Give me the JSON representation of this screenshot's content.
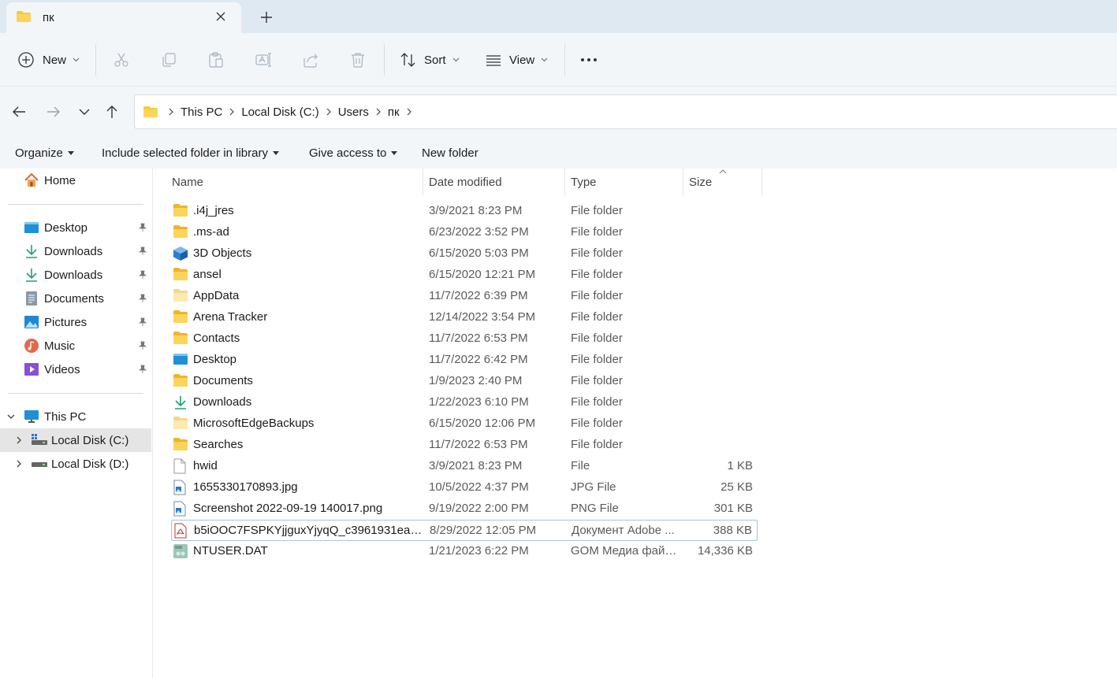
{
  "tab": {
    "title": "пк"
  },
  "toolbar": {
    "new_label": "New",
    "sort_label": "Sort",
    "view_label": "View"
  },
  "breadcrumb": [
    "This PC",
    "Local Disk (C:)",
    "Users",
    "пк"
  ],
  "legacy": {
    "organize": "Organize",
    "include": "Include selected folder in library",
    "give_access": "Give access to",
    "new_folder": "New folder"
  },
  "nav": {
    "home": "Home",
    "quick": [
      "Desktop",
      "Downloads",
      "Downloads",
      "Documents",
      "Pictures",
      "Music",
      "Videos"
    ],
    "this_pc": "This PC",
    "disk_c": "Local Disk (C:)",
    "disk_d": "Local Disk (D:)"
  },
  "columns": {
    "name": "Name",
    "date": "Date modified",
    "type": "Type",
    "size": "Size"
  },
  "files": [
    {
      "name": ".i4j_jres",
      "date": "3/9/2021 8:23 PM",
      "type": "File folder",
      "size": "",
      "icon": "folder"
    },
    {
      "name": ".ms-ad",
      "date": "6/23/2022 3:52 PM",
      "type": "File folder",
      "size": "",
      "icon": "folder"
    },
    {
      "name": "3D Objects",
      "date": "6/15/2020 5:03 PM",
      "type": "File folder",
      "size": "",
      "icon": "cube"
    },
    {
      "name": "ansel",
      "date": "6/15/2020 12:21 PM",
      "type": "File folder",
      "size": "",
      "icon": "folder"
    },
    {
      "name": "AppData",
      "date": "11/7/2022 6:39 PM",
      "type": "File folder",
      "size": "",
      "icon": "folder-light"
    },
    {
      "name": "Arena Tracker",
      "date": "12/14/2022 3:54 PM",
      "type": "File folder",
      "size": "",
      "icon": "folder"
    },
    {
      "name": "Contacts",
      "date": "11/7/2022 6:53 PM",
      "type": "File folder",
      "size": "",
      "icon": "folder"
    },
    {
      "name": "Desktop",
      "date": "11/7/2022 6:42 PM",
      "type": "File folder",
      "size": "",
      "icon": "desktop"
    },
    {
      "name": "Documents",
      "date": "1/9/2023 2:40 PM",
      "type": "File folder",
      "size": "",
      "icon": "folder"
    },
    {
      "name": "Downloads",
      "date": "1/22/2023 6:10 PM",
      "type": "File folder",
      "size": "",
      "icon": "download"
    },
    {
      "name": "MicrosoftEdgeBackups",
      "date": "6/15/2020 12:06 PM",
      "type": "File folder",
      "size": "",
      "icon": "folder-light"
    },
    {
      "name": "Searches",
      "date": "11/7/2022 6:53 PM",
      "type": "File folder",
      "size": "",
      "icon": "folder"
    },
    {
      "name": "hwid",
      "date": "3/9/2021 8:23 PM",
      "type": "File",
      "size": "1 KB",
      "icon": "file"
    },
    {
      "name": "1655330170893.jpg",
      "date": "10/5/2022 4:37 PM",
      "type": "JPG File",
      "size": "25 KB",
      "icon": "image"
    },
    {
      "name": "Screenshot 2022-09-19 140017.png",
      "date": "9/19/2022 2:00 PM",
      "type": "PNG File",
      "size": "301 KB",
      "icon": "image"
    },
    {
      "name": "b5iOOC7FSPKYjjguxYjyqQ_c3961931ea1d...",
      "date": "8/29/2022 12:05 PM",
      "type": "Документ Adobe ...",
      "size": "388 KB",
      "icon": "pdf"
    },
    {
      "name": "NTUSER.DAT",
      "date": "1/21/2023 6:22 PM",
      "type": "GOM Медиа файл...",
      "size": "14,336 KB",
      "icon": "dat"
    }
  ],
  "colors": {
    "accent": "#0067c0",
    "folder": "#f8c93c",
    "chrome": "#f3f6f9",
    "tabstrip": "#dfe9f1"
  }
}
